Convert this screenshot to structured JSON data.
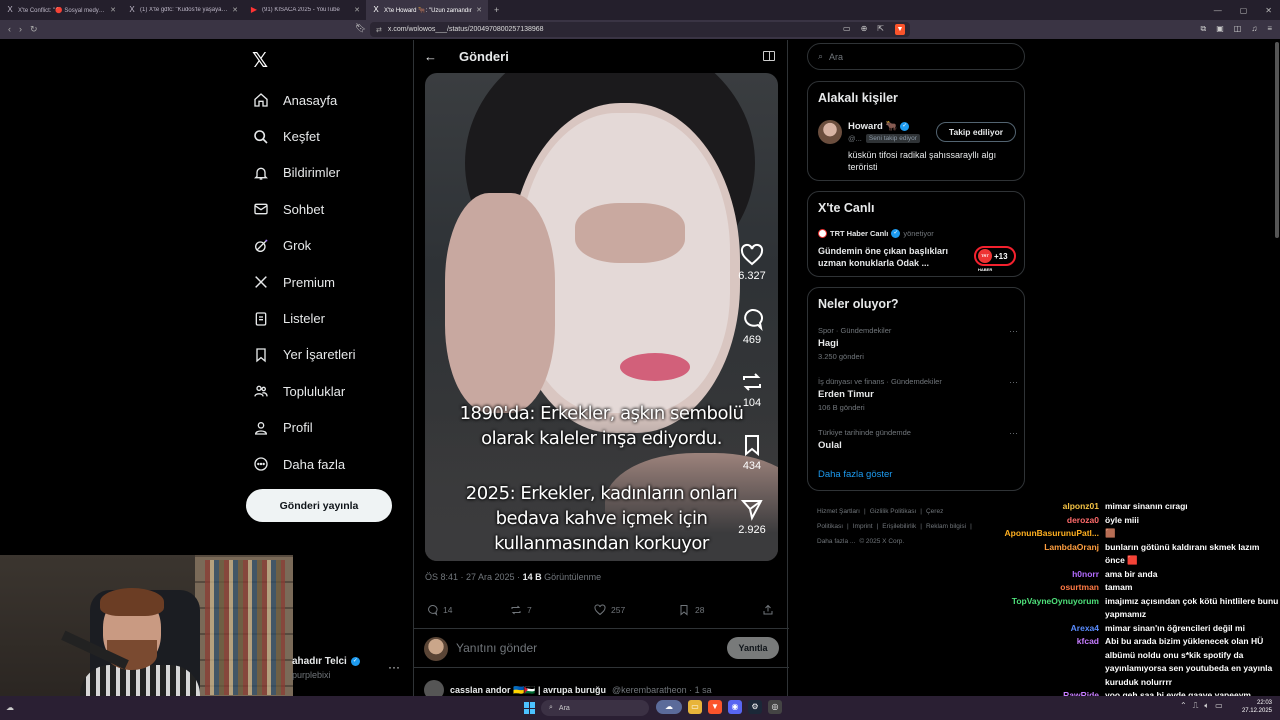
{
  "browser": {
    "tabs": [
      {
        "icon": "X",
        "label": "X'te Conflict: \"🔴 Sosyal medya fenomenleri",
        "active": false
      },
      {
        "icon": "X",
        "label": "(1) X'te gdfc: \"Kudos'te yaşayan bir no",
        "active": false
      },
      {
        "icon": "▶",
        "label": "(91) KISACA 2025 - YouTube",
        "active": false
      },
      {
        "icon": "X",
        "label": "X'te Howard 🐂: \"Uzun zamandır",
        "active": true
      }
    ],
    "new_tab": "+",
    "url": "x.com/wolowos___/status/2004970800257138968"
  },
  "sidebar": {
    "logo": "𝕏",
    "items": [
      {
        "label": "Anasayfa",
        "icon": "home-icon"
      },
      {
        "label": "Keşfet",
        "icon": "search-icon"
      },
      {
        "label": "Bildirimler",
        "icon": "bell-icon"
      },
      {
        "label": "Sohbet",
        "icon": "mail-icon"
      },
      {
        "label": "Grok",
        "icon": "grok-icon"
      },
      {
        "label": "Premium",
        "icon": "x-icon"
      },
      {
        "label": "Listeler",
        "icon": "list-icon"
      },
      {
        "label": "Yer İşaretleri",
        "icon": "bookmark-icon"
      },
      {
        "label": "Topluluklar",
        "icon": "people-icon"
      },
      {
        "label": "Profil",
        "icon": "person-icon"
      },
      {
        "label": "Daha fazla",
        "icon": "more-circle-icon"
      }
    ],
    "post_button": "Gönderi yayınla",
    "account": {
      "name": "ahadır Telci",
      "handle": "purplebixi",
      "more": "···"
    }
  },
  "main": {
    "title": "Gönderi",
    "video": {
      "caption1": [
        "1890'da: Erkekler, aşkın sembolü",
        "olarak kaleler inşa ediyordu."
      ],
      "caption2": [
        "2025: Erkekler, kadınların onları",
        "bedava kahve içmek için",
        "kullanmasından korkuyor"
      ],
      "actions": {
        "likes": "6.327",
        "comments": "469",
        "reposts": "104",
        "bookmarks": "434",
        "shares": "2.926"
      }
    },
    "meta": {
      "time": "ÖS 8:41 · 27 Ara 2025 · ",
      "views": "14 B",
      "views_label": " Görüntülenme"
    },
    "stats": {
      "replies": "14",
      "reposts": "7",
      "likes": "257",
      "bookmarks": "28"
    },
    "reply": {
      "placeholder": "Yanıtını gönder",
      "button": "Yanıtla"
    },
    "next_reply": {
      "name": "casslan andor 🇺🇦🇵🇸 | avrupa buruğu",
      "handle": "@kerembaratheon · 1 sa"
    }
  },
  "right": {
    "search_placeholder": "Ara",
    "related": {
      "title": "Alakalı kişiler",
      "name": "Howard 🐂",
      "handle": "@...",
      "follows_you": "Seni takip ediyor",
      "follow_button": "Takip ediliyor",
      "bio": "küskün tifosi radikal şahıssarayllı algı teröristi"
    },
    "live": {
      "title": "X'te Canlı",
      "host": "TRT Haber Canlı",
      "host_role": "yönetiyor",
      "text": "Gündemin öne çıkan başlıkları uzman konuklarla Odak ...",
      "mini": "TRT HABER",
      "extra": "+13"
    },
    "trends": {
      "title": "Neler oluyor?",
      "items": [
        {
          "category": "Spor · Gündemdekiler",
          "name": "Hagi",
          "count": "3.250 gönderi"
        },
        {
          "category": "İş dünyası ve finans · Gündemdekiler",
          "name": "Erden Timur",
          "count": "106 B gönderi"
        },
        {
          "category": "Türkiye tarihinde gündemde",
          "name": "Oulal",
          "count": ""
        }
      ],
      "more_icon": "···",
      "show_more": "Daha fazla göster"
    },
    "footer": [
      "Hizmet Şartları",
      "|",
      "Gizlilik Politikası",
      "|",
      "Çerez Politikası",
      "|",
      "Imprint",
      "|",
      "Erişilebilirlik",
      "|",
      "Reklam bilgisi",
      "|",
      "Daha fazla ...",
      "© 2025 X Corp."
    ]
  },
  "chat": [
    {
      "name": "alponz01",
      "color": "#f6c445",
      "text": "mimar sinanın cıragı"
    },
    {
      "name": "deroza0",
      "color": "#ff6b6b",
      "text": "öyle miii"
    },
    {
      "name": "AponunBasurunuPatl...",
      "color": "#ffb020",
      "text": "🟫"
    },
    {
      "name": "LambdaOranj",
      "color": "#ff9f40",
      "text": "bunların götünü kaldıranı skmek lazım önce 🟥"
    },
    {
      "name": "h0norr",
      "color": "#b36bff",
      "text": "ama bir anda"
    },
    {
      "name": "osurtman",
      "color": "#ff7a45",
      "text": "tamam"
    },
    {
      "name": "TopVayneOynuyorum",
      "color": "#4ee07a",
      "text": "imajımız açısından çok kötü hintlilere bunu yapmamız"
    },
    {
      "name": "Arexa4",
      "color": "#5a8dff",
      "text": "mimar sinan'ın öğrencileri değil mi"
    },
    {
      "name": "kfcad",
      "color": "#c77dff",
      "text": "Abi bu arada bizim yüklenecek olan HÜ albümü noldu onu s*kik spotify da yayınlamıyorsa sen youtubeda en yayınla kuruduk nolurrrr"
    },
    {
      "name": "RawRide",
      "color": "#c77dff",
      "text": "yoo geh saa bi evde gaave yapeeym"
    }
  ],
  "taskbar": {
    "search": "Ara",
    "time": "22:03",
    "date": "27.12.2025"
  }
}
